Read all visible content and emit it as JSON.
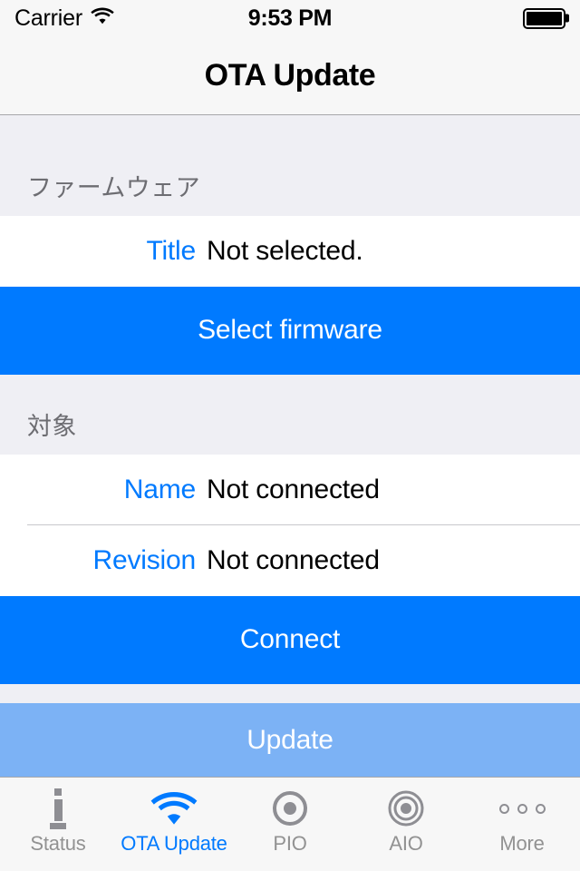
{
  "status_bar": {
    "carrier": "Carrier",
    "wifi_icon": "wifi-icon",
    "time": "9:53 PM",
    "battery_icon": "battery-full-icon",
    "battery_level": 100
  },
  "nav_bar": {
    "title": "OTA Update"
  },
  "sections": [
    {
      "header": "ファームウェア",
      "rows": [
        {
          "label": "Title",
          "value": "Not selected."
        }
      ],
      "buttons": [
        {
          "label": "Select firmware",
          "style": "primary",
          "enabled": true
        }
      ]
    },
    {
      "header": "対象",
      "rows": [
        {
          "label": "Name",
          "value": "Not connected"
        },
        {
          "label": "Revision",
          "value": "Not connected"
        }
      ],
      "buttons": [
        {
          "label": "Connect",
          "style": "primary",
          "enabled": true
        },
        {
          "label": "Update",
          "style": "disabled",
          "enabled": false
        }
      ]
    }
  ],
  "tab_bar": {
    "active_index": 1,
    "items": [
      {
        "label": "Status",
        "icon": "info-icon"
      },
      {
        "label": "OTA Update",
        "icon": "wifi-icon"
      },
      {
        "label": "PIO",
        "icon": "target-single-ring-icon"
      },
      {
        "label": "AIO",
        "icon": "target-double-ring-icon"
      },
      {
        "label": "More",
        "icon": "ellipsis-circles-icon"
      }
    ]
  },
  "colors": {
    "accent": "#007AFF",
    "accent_disabled": "#7CB2F5",
    "bar_background": "#F7F7F7",
    "group_background": "#EFEFF4",
    "cell_background": "#FFFFFF",
    "secondary_text": "#6D6D72",
    "tab_inactive": "#929292"
  }
}
